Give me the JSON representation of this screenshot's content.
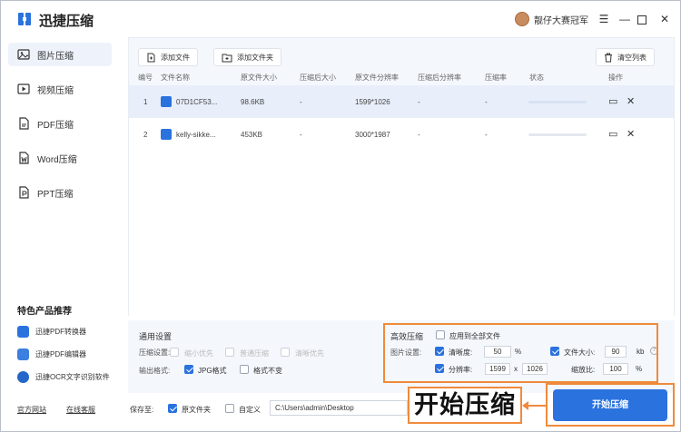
{
  "app": {
    "title": "迅捷压缩",
    "username": "靓仔大赛冠军"
  },
  "sidebar": {
    "items": [
      {
        "label": "图片压缩",
        "icon": "image-icon"
      },
      {
        "label": "视频压缩",
        "icon": "video-icon"
      },
      {
        "label": "PDF压缩",
        "icon": "pdf-icon"
      },
      {
        "label": "Word压缩",
        "icon": "word-icon"
      },
      {
        "label": "PPT压缩",
        "icon": "ppt-icon"
      }
    ],
    "promo_title": "特色产品推荐",
    "promos": [
      {
        "label": "迅捷PDF转换器",
        "color": "#2a72de"
      },
      {
        "label": "迅捷PDF编辑器",
        "color": "#2a72de"
      },
      {
        "label": "迅捷OCR文字识别软件",
        "color": "#2a72de"
      }
    ],
    "footer_links": [
      "官方网站",
      "在线客服"
    ]
  },
  "toolbar": {
    "add_file": "添加文件",
    "add_folder": "添加文件夹",
    "clear_list": "清空列表"
  },
  "table": {
    "headers": [
      "编号",
      "文件名称",
      "原文件大小",
      "压缩后大小",
      "原文件分辨率",
      "压缩后分辨率",
      "压缩率",
      "状态",
      "操作"
    ],
    "rows": [
      {
        "index": "1",
        "name": "07D1CF53...",
        "size": "98.6KB",
        "compressed_size": "-",
        "resolution": "1599*1026",
        "compressed_resolution": "-",
        "ratio": "-"
      },
      {
        "index": "2",
        "name": "kelly-sikke...",
        "size": "453KB",
        "compressed_size": "-",
        "resolution": "3000*1987",
        "compressed_resolution": "-",
        "ratio": "-"
      }
    ]
  },
  "general": {
    "title": "通用设置",
    "compress_label": "压缩设置:",
    "compress_options": [
      "缩小优先",
      "普通压缩",
      "清晰优先"
    ],
    "output_label": "输出格式:",
    "output_options": [
      {
        "label": "JPG格式",
        "checked": true
      },
      {
        "label": "格式不变",
        "checked": false
      }
    ]
  },
  "efficient": {
    "title": "高效压缩",
    "apply_all": "应用到全部文件",
    "image_settings_label": "图片设置:",
    "clarity_label": "清晰度:",
    "clarity_value": "50",
    "clarity_unit": "%",
    "filesize_label": "文件大小:",
    "filesize_value": "90",
    "filesize_unit": "kb",
    "resolution_label": "分辨率:",
    "res_w": "1599",
    "res_x": "x",
    "res_h": "1026",
    "scale_label": "缩放比:",
    "scale_value": "100",
    "scale_unit": "%"
  },
  "save": {
    "label": "保存至:",
    "original_folder": "原文件夹",
    "custom": "自定义",
    "path": "C:\\Users\\admin\\Desktop",
    "more": "..."
  },
  "callout": "开始压缩",
  "start_button": "开始压缩",
  "colors": {
    "accent": "#2a72de",
    "highlight": "#f08a3b"
  }
}
